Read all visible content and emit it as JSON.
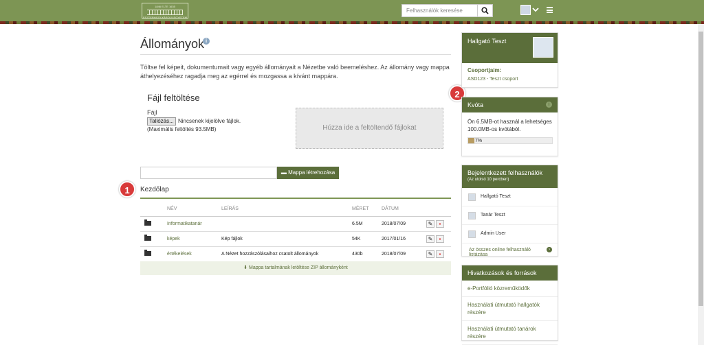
{
  "header": {
    "logo_line1": "1846 ELTE 1635",
    "logo_line2": "ESZTERHÁZY KÁROLY EGYETEM",
    "search_placeholder": "Felhasználók keresése"
  },
  "page": {
    "title": "Állományok",
    "intro": "Töltse fel képeit, dokumentumait vagy egyéb állományait a Nézetbe való beemeléshez. Az állomány vagy mappa áthelyezéséhez ragadja meg az egérrel és mozgassa a kívánt mappára."
  },
  "upload": {
    "title": "Fájl feltöltése",
    "file_label": "Fájl",
    "browse_label": "Tallózás...",
    "no_file": "Nincsenek kijelölve fájlok.",
    "max_size": "(Maximális feltöltés 93.5MB)",
    "dropzone": "Húzza ide a feltöltendő fájlokat"
  },
  "folder": {
    "input_value": "",
    "create_label": "Mappa létrehozása"
  },
  "badges": {
    "one": "1",
    "two": "2"
  },
  "breadcrumb": "Kezdőlap",
  "table": {
    "headers": {
      "name": "NÉV",
      "desc": "LEÍRÁS",
      "size": "MÉRET",
      "date": "DÁTUM"
    },
    "rows": [
      {
        "name": "Informatikatanár",
        "desc": "",
        "size": "6.5M",
        "date": "2018/07/09"
      },
      {
        "name": "képek",
        "desc": "Kép fájlok",
        "size": "54K",
        "date": "2017/01/16"
      },
      {
        "name": "értékelések",
        "desc": "A Nézet hozzászólásaihoz csatolt állományok",
        "size": "430b",
        "date": "2018/07/09"
      }
    ],
    "zip_label": "Mappa tartalmának letöltése ZIP állományként"
  },
  "sidebar": {
    "profile": {
      "name": "Hallgató Teszt",
      "groups_label": "Csoportjaim:",
      "group": "ASD123 - Teszt csoport"
    },
    "quota": {
      "title": "Kvóta",
      "text": "Ön 6.5MB-ot használ a lehetséges 100.0MB-os kvótából.",
      "percent_label": "7%",
      "percent": 7
    },
    "online": {
      "title": "Bejelentkezett felhasználók",
      "subtitle": "(Az utolsó 10 percben)",
      "users": [
        "Hallgató Teszt",
        "Tanár Teszt",
        "Admin User"
      ],
      "list_link": "Az összes online felhasználó listázása"
    },
    "links": {
      "title": "Hivatkozások és források",
      "items": [
        "e-Portfólió közreműködők",
        "Használati útmutató hallgatók részére",
        "Használati útmutató tanárok részére"
      ]
    }
  },
  "colors": {
    "brand": "#7d9554",
    "brand_dark": "#5b6e3a",
    "badge": "#d83a3a"
  }
}
